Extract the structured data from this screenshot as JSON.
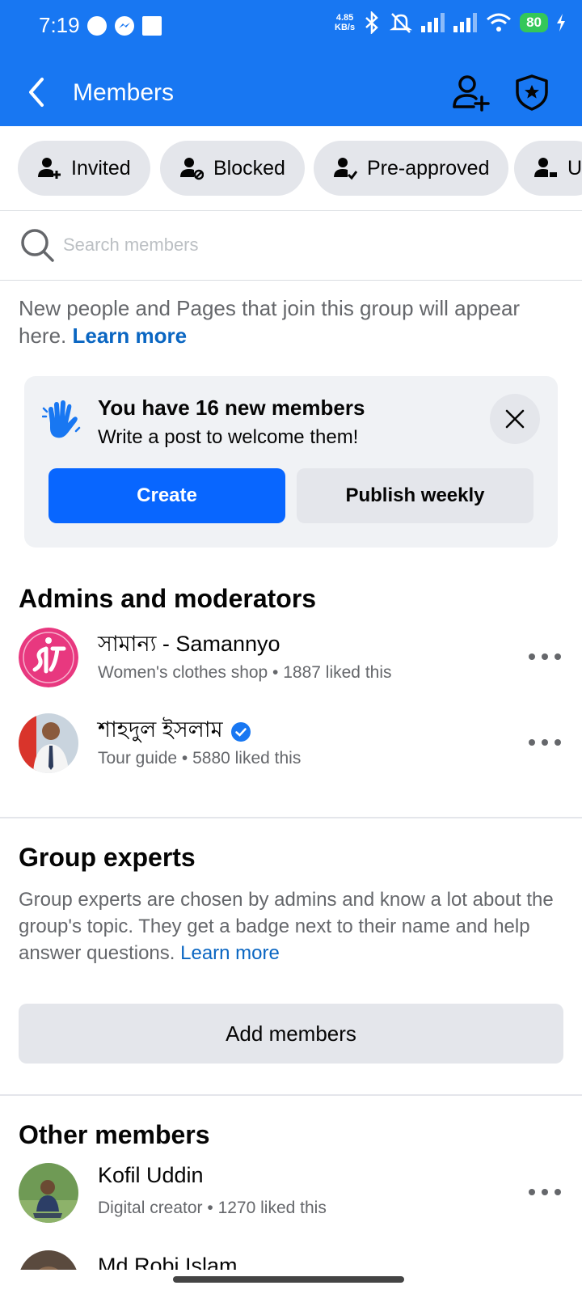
{
  "status_bar": {
    "time": "7:19",
    "net_speed_value": "4.85",
    "net_speed_unit": "KB/s",
    "battery": "80"
  },
  "app_bar": {
    "title": "Members"
  },
  "chips": [
    {
      "label": "Invited"
    },
    {
      "label": "Blocked"
    },
    {
      "label": "Pre-approved"
    },
    {
      "label": "U"
    }
  ],
  "search": {
    "placeholder": "Search members"
  },
  "info": {
    "text": "New people and Pages that join this group will appear here.",
    "link": "Learn more"
  },
  "welcome_card": {
    "title": "You have 16 new members",
    "subtitle": "Write a post to welcome them!",
    "create_label": "Create",
    "publish_label": "Publish weekly"
  },
  "admins": {
    "heading": "Admins and moderators",
    "items": [
      {
        "name": "সামান্য - Samannyo",
        "meta": "Women's clothes shop • 1887 liked this"
      },
      {
        "name": "শাহদুল ইসলাম",
        "meta": "Tour guide • 5880 liked this"
      }
    ]
  },
  "experts": {
    "heading": "Group experts",
    "text": "Group experts are chosen by admins and know a lot about the group's topic. They get a badge next to their name and help answer questions.",
    "link": "Learn more",
    "add_label": "Add members"
  },
  "others": {
    "heading": "Other members",
    "items": [
      {
        "name": "Kofil Uddin",
        "meta": "Digital creator • 1270 liked this"
      },
      {
        "name": "Md Robi Islam",
        "meta": ""
      }
    ]
  },
  "colors": {
    "brand_blue": "#1877f2",
    "button_blue": "#0866ff",
    "link_blue": "#0a66c2",
    "chip_gray": "#e4e6eb"
  }
}
